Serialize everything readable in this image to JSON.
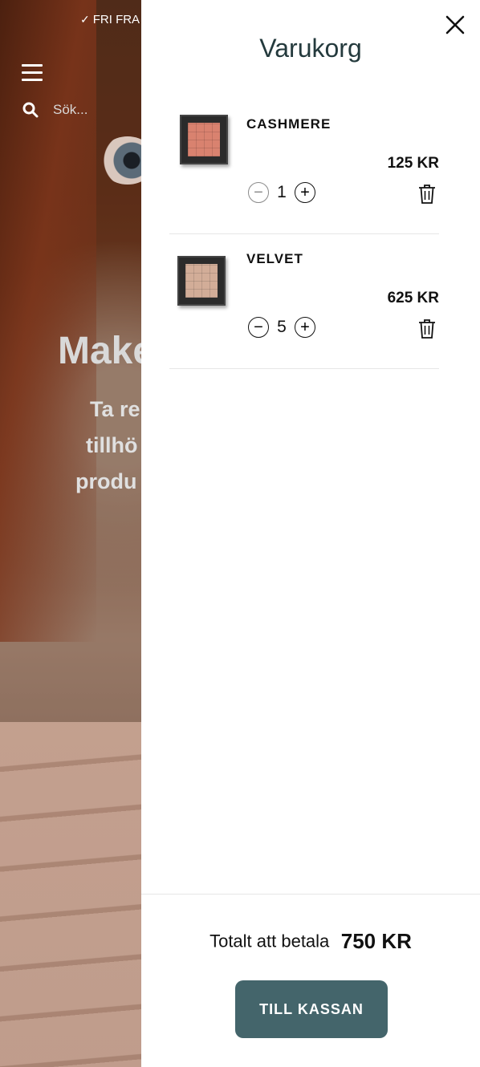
{
  "background": {
    "announcement": "FRI FRA",
    "search_placeholder": "Sök...",
    "hero_title": "Make",
    "hero_subtitle_lines": [
      "Ta re",
      "tillhö",
      "produ"
    ]
  },
  "cart": {
    "title": "Varukorg",
    "items": [
      {
        "name": "CASHMERE",
        "price": "125 KR",
        "quantity": "1",
        "swatch_color": "#d9826f"
      },
      {
        "name": "VELVET",
        "price": "625 KR",
        "quantity": "5",
        "swatch_color": "#d2ad98"
      }
    ],
    "total_label": "Totalt att betala",
    "total_value": "750 KR",
    "checkout_label": "TILL KASSAN"
  },
  "colors": {
    "accent": "#44656b",
    "title": "#243a3d"
  }
}
